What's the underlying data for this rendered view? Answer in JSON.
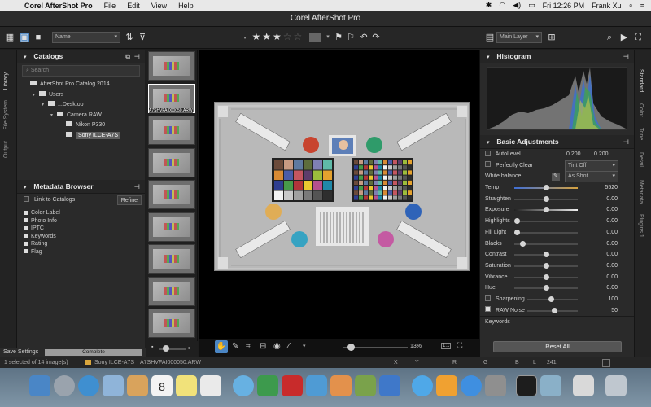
{
  "menubar": {
    "app_name": "Corel AfterShot Pro",
    "menus": [
      "File",
      "Edit",
      "View",
      "Help"
    ],
    "clock": "Fri 12:26 PM",
    "user": "Frank Xu"
  },
  "window": {
    "title": "Corel AfterShot Pro"
  },
  "toolbar": {
    "sort_value": "Name",
    "rating_filled": "★★★",
    "rating_empty": "☆☆",
    "layer_value": "Main Layer"
  },
  "left_tabs": [
    "Library",
    "File System",
    "Output"
  ],
  "catalogs": {
    "title": "Catalogs",
    "search_placeholder": "Search",
    "tree": [
      {
        "label": "AfterShot Pro Catalog 2014",
        "indent": 0,
        "arrow": ""
      },
      {
        "label": "Users",
        "indent": 1,
        "arrow": "▾"
      },
      {
        "label": "...Desktop",
        "indent": 2,
        "arrow": "▾"
      },
      {
        "label": "Camera RAW",
        "indent": 3,
        "arrow": "▾"
      },
      {
        "label": "Nikon P330",
        "indent": 4,
        "arrow": ""
      },
      {
        "label": "Sony ILCE-A7S",
        "indent": 4,
        "arrow": ""
      }
    ]
  },
  "metadata_browser": {
    "title": "Metadata Browser",
    "link_label": "Link to Catalogs",
    "refine_label": "Refine",
    "items": [
      "Color Label",
      "Photo Info",
      "IPTC",
      "Keywords",
      "Rating",
      "Flag"
    ]
  },
  "filmstrip": {
    "selected_caption": "A7SHVFAI000050.ARW"
  },
  "viewer": {
    "zoom_label": "13%",
    "ratio_label": "1:1"
  },
  "right_tabs": [
    "Standard",
    "Color",
    "Tone",
    "Detail",
    "Metadata",
    "Plugins 1"
  ],
  "histogram": {
    "title": "Histogram"
  },
  "basic_adjustments": {
    "title": "Basic Adjustments",
    "auto_level": {
      "label": "AutoLevel",
      "v1": "0.200",
      "v2": "0.200"
    },
    "perfectly_clear": {
      "label": "Perfectly Clear",
      "value": "Tint Off"
    },
    "white_balance": {
      "label": "White balance",
      "value": "As Shot"
    },
    "sliders": [
      {
        "label": "Temp",
        "value": "5520",
        "pos": 0.5
      },
      {
        "label": "Straighten",
        "value": "0.00",
        "pos": 0.5
      },
      {
        "label": "Exposure",
        "value": "0.00",
        "pos": 0.5
      },
      {
        "label": "Highlights",
        "value": "0.00",
        "pos": 0.0
      },
      {
        "label": "Fill Light",
        "value": "0.00",
        "pos": 0.0
      },
      {
        "label": "Blacks",
        "value": "0.00",
        "pos": 0.1
      },
      {
        "label": "Contrast",
        "value": "0.00",
        "pos": 0.5
      },
      {
        "label": "Saturation",
        "value": "0.00",
        "pos": 0.5
      },
      {
        "label": "Vibrance",
        "value": "0.00",
        "pos": 0.5
      },
      {
        "label": "Hue",
        "value": "0.00",
        "pos": 0.5
      }
    ],
    "sharpening": {
      "label": "Sharpening",
      "value": "100"
    },
    "raw_noise": {
      "label": "RAW Noise",
      "value": "50"
    },
    "keywords_label": "Keywords",
    "reset_label": "Reset All"
  },
  "save": {
    "label": "Save Settings",
    "progress_label": "Complete"
  },
  "status": {
    "selection": "1 selected of 14 image(s)",
    "camera": "Sony ILCE-A7S",
    "filename": "A7SHVFAI000050.ARW",
    "x_label": "X",
    "y_label": "Y",
    "r_label": "R",
    "g_label": "G",
    "b_label": "B",
    "l_label": "L",
    "l_value": "241"
  },
  "dock": {
    "calendar_day": "8"
  }
}
